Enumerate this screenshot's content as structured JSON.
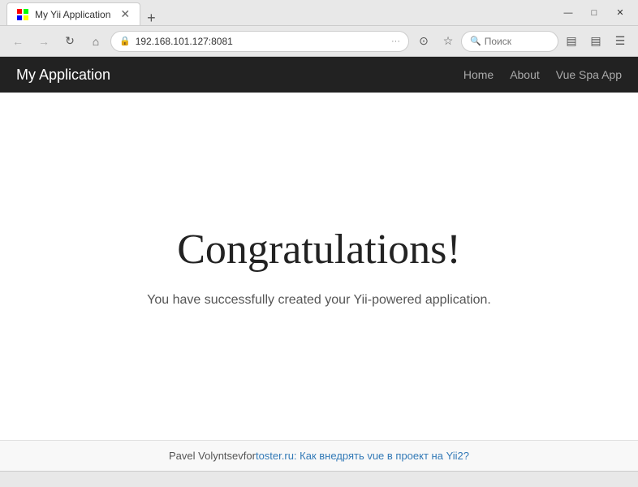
{
  "browser": {
    "tab": {
      "title": "My Yii Application",
      "favicon": "🔷"
    },
    "new_tab_btn": "+",
    "window_controls": {
      "minimize": "—",
      "maximize": "□",
      "close": "✕"
    },
    "nav": {
      "back_disabled": true,
      "forward_disabled": true,
      "reload_label": "↻",
      "home_label": "⌂"
    },
    "address": {
      "icon": "🔒",
      "url": "192.168.101.127:8081",
      "more_label": "···"
    },
    "toolbar_icons": {
      "pocket": "⊙",
      "bookmark": "☆",
      "reader": "📖",
      "sidebar": "▤",
      "menu": "☰"
    },
    "search": {
      "placeholder": "Поиск"
    }
  },
  "app": {
    "brand": "My Application",
    "nav": {
      "home": "Home",
      "about": "About",
      "vue_spa": "Vue Spa App"
    }
  },
  "main": {
    "title": "Congratulations!",
    "subtitle": "You have successfully created your Yii-powered application."
  },
  "footer": {
    "author": "Pavel Volyntsev",
    "connector": " for ",
    "link_text": "toster.ru: Как внедрять vue в проект на Yii2?",
    "link_url": "#"
  }
}
